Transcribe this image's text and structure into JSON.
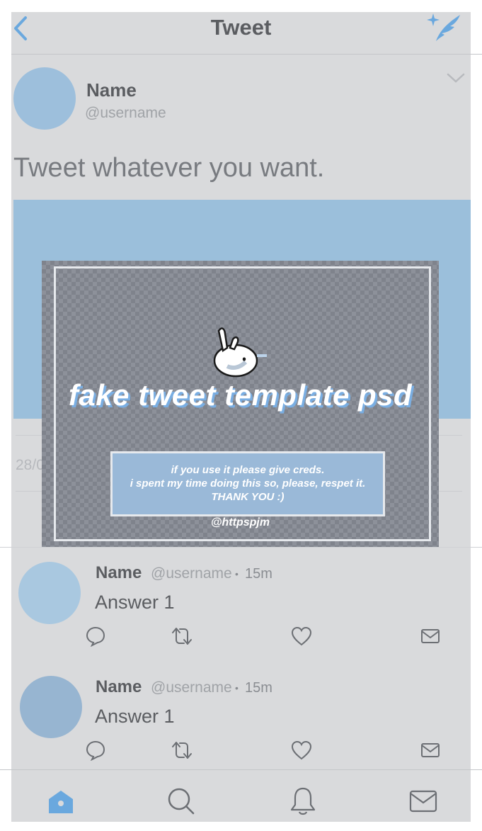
{
  "header": {
    "title": "Tweet"
  },
  "tweet": {
    "name": "Name",
    "username": "@username",
    "text": "Tweet whatever you want.",
    "date_partial": "28/0"
  },
  "overlay": {
    "title": "fake tweet template psd",
    "note_line1": "if you use it please give creds.",
    "note_line2": "i spent my time doing this so, please, respet it.",
    "note_line3": "THANK YOU :)",
    "credit": "@httpspjm"
  },
  "replies": [
    {
      "name": "Name",
      "username": "@username",
      "dot": "•",
      "time": "15m",
      "text": "Answer 1",
      "avatar_color": "#a9c8e0"
    },
    {
      "name": "Name",
      "username": "@username",
      "dot": "•",
      "time": "15m",
      "text": "Answer 1",
      "avatar_color": "#97b5d1"
    }
  ],
  "colors": {
    "accent": "#6aa8de",
    "icon_gray": "#6c6f74"
  },
  "icons": {
    "back": "chevron-left-icon",
    "compose": "quill-sparkle-icon",
    "more": "chevron-down-icon",
    "reply": "speech-bubble-icon",
    "retweet": "retweet-icon",
    "like": "heart-icon",
    "dm": "envelope-icon",
    "nav": [
      "home-icon",
      "search-icon",
      "bell-icon",
      "envelope-icon"
    ]
  }
}
